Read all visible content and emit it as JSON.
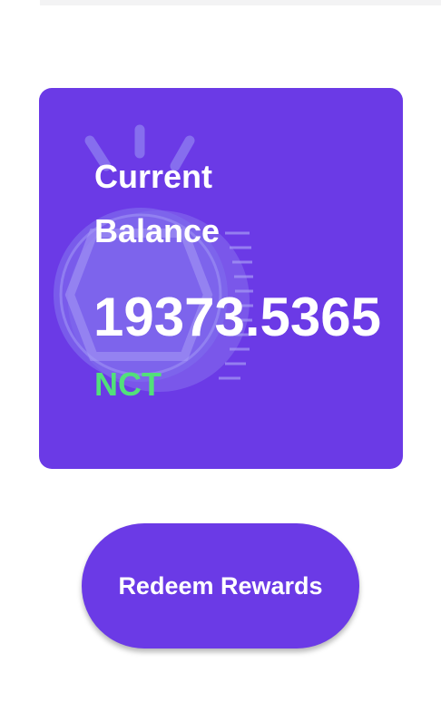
{
  "balance": {
    "label": "Current Balance",
    "amount": "19373.5365",
    "currency": "NCT"
  },
  "actions": {
    "redeem_label": "Redeem Rewards"
  },
  "colors": {
    "card_background": "#6b3ae6",
    "currency_accent": "#52e07a",
    "button_background": "#6b3ae6",
    "text_primary": "#ffffff"
  },
  "icons": {
    "card_decoration": "coin-icon"
  }
}
